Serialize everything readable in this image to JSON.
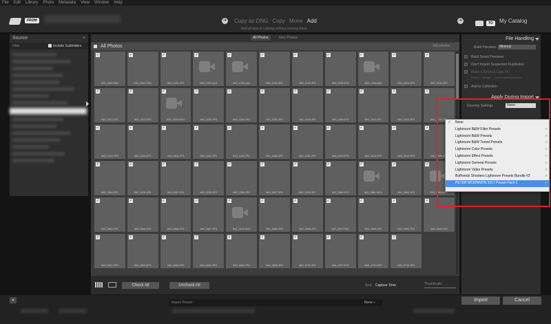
{
  "menubar": [
    "File",
    "Edit",
    "Library",
    "Photo",
    "Metadata",
    "View",
    "Window",
    "Help"
  ],
  "header": {
    "from_badge": "FROM",
    "modes": [
      "Copy as DNG",
      "Copy",
      "Move",
      "Add"
    ],
    "active_mode": "Add",
    "mode_subtitle": "Add photos to catalog without moving them",
    "to_badge": "TO",
    "destination": "My Catalog"
  },
  "source": {
    "title": "Source",
    "add": "+",
    "path_label": "Files",
    "include_subfolders": "Include Subfolders"
  },
  "center": {
    "tabs": [
      "All Photos",
      "New Photos"
    ],
    "section_title": "All Photos",
    "photo_count": "349 photos",
    "photos": [
      {
        "name": "IMG_0150.PNG",
        "video": false
      },
      {
        "name": "IMG_0151.PNG",
        "video": false
      },
      {
        "name": "IMG_0190.JPG",
        "video": false
      },
      {
        "name": "IMG_0191.mp4",
        "video": true
      },
      {
        "name": "IMG_0192.mp4",
        "video": true
      },
      {
        "name": "IMG_0193.JPG",
        "video": false
      },
      {
        "name": "IMG_0194.JPG",
        "video": false
      },
      {
        "name": "IMG_0195.JPG",
        "video": false
      },
      {
        "name": "IMG_0196.mp4",
        "video": true
      },
      {
        "name": "IMG_0201.JPG",
        "video": false
      },
      {
        "name": "IMG_0211.JPG",
        "video": false
      },
      {
        "name": "IMG_0212.JPG",
        "video": false
      },
      {
        "name": "IMG_0215.JPG",
        "video": false
      },
      {
        "name": "IMG_0220.MOV",
        "video": true
      },
      {
        "name": "IMG_0228.JPG",
        "video": false
      },
      {
        "name": "IMG_0244.JPG",
        "video": false
      },
      {
        "name": "IMG_0293.JPG",
        "video": false
      },
      {
        "name": "IMG_0294.JPG",
        "video": false
      },
      {
        "name": "IMG_0399.JPG",
        "video": false
      },
      {
        "name": "IMG_0412.JPG",
        "video": false
      },
      {
        "name": "IMG_0413.JPG",
        "video": false
      },
      {
        "name": "IMG_0414.JPG",
        "video": false
      },
      {
        "name": "IMG_0415.JPG",
        "video": false
      },
      {
        "name": "IMG_0418.JPG",
        "video": false
      },
      {
        "name": "IMG_0468.JPG",
        "video": false
      },
      {
        "name": "IMG_0481.JPG",
        "video": false
      },
      {
        "name": "IMG_0482.JPG",
        "video": false
      },
      {
        "name": "IMG_0488.JPG",
        "video": false
      },
      {
        "name": "IMG_0491.JPG",
        "video": false
      },
      {
        "name": "IMG_0493.JPG",
        "video": false
      },
      {
        "name": "IMG_0516.JPG",
        "video": false
      },
      {
        "name": "IMG_0519.JPG",
        "video": false
      },
      {
        "name": "IMG_0520.JPG",
        "video": false
      },
      {
        "name": "IMG_0544.JPG",
        "video": false
      },
      {
        "name": "IMG_0530.JPG",
        "video": false
      },
      {
        "name": "IMG_0537.JPG",
        "video": false
      },
      {
        "name": "IMG_0535.JPG",
        "video": false
      },
      {
        "name": "IMG_0536.JPG",
        "video": false
      },
      {
        "name": "IMG_0537.JPG",
        "video": false
      },
      {
        "name": "IMG_0539.JPG",
        "video": false
      },
      {
        "name": "IMG_0560.JPG",
        "video": false
      },
      {
        "name": "IMG_0561.MOV",
        "video": true
      },
      {
        "name": "IMG_0562.JPG",
        "video": false
      },
      {
        "name": "IMG_0563.MOV",
        "video": true
      },
      {
        "name": "IMG_0564.JPG",
        "video": false
      },
      {
        "name": "IMG_0565.JPG",
        "video": false
      },
      {
        "name": "IMG_0566.JPG",
        "video": false
      },
      {
        "name": "IMG_0567.JPG",
        "video": false
      },
      {
        "name": "IMG_0574.MOV",
        "video": true
      },
      {
        "name": "IMG_0586.JPG",
        "video": false
      },
      {
        "name": "IMG_0588.JPG",
        "video": false
      },
      {
        "name": "IMG_0597.PNG",
        "video": false
      },
      {
        "name": "IMG_0598.JPG",
        "video": false
      },
      {
        "name": "IMG_0599.JPG",
        "video": false
      },
      {
        "name": "IMG_0600.JPG",
        "video": false
      },
      {
        "name": "IMG_0627.JPG",
        "video": false
      },
      {
        "name": "IMG_0649.JPG",
        "video": false
      },
      {
        "name": "IMG_0650.JPG",
        "video": false
      },
      {
        "name": "IMG_0652.JPG",
        "video": false
      },
      {
        "name": "IMG_0654.JPG",
        "video": false
      },
      {
        "name": "IMG_0696.JPG",
        "video": false
      },
      {
        "name": "IMG_0702.JPG",
        "video": false
      },
      {
        "name": "IMG_0707.JPG",
        "video": false
      },
      {
        "name": "IMG_0710.JPG",
        "video": false
      },
      {
        "name": "IMG_0713.JPG",
        "video": false
      }
    ],
    "check_all": "Check All",
    "uncheck_all": "Uncheck All",
    "sort_label": "Sort:",
    "sort_value": "Capture Time",
    "thumbnails_label": "Thumbnails"
  },
  "file_handling": {
    "title": "File Handling",
    "build_previews_label": "Build Previews",
    "build_previews_value": "Minimal",
    "build_smart_previews": "Build Smart Previews",
    "dont_import_duplicates": "Don't Import Suspected Duplicates",
    "make_second_copy": "Make a Second Copy To:",
    "second_copy_path": "/Users/.../Image ... Downloaded Backups",
    "add_to_collection": "Add to Collection"
  },
  "apply_during_import": {
    "title": "Apply During Import",
    "develop_settings_label": "Develop Settings",
    "develop_settings_value": "None",
    "options": [
      {
        "label": "None",
        "checked": true,
        "submenu": false
      },
      {
        "label": "Lightroom B&W Filter Presets",
        "checked": false,
        "submenu": true
      },
      {
        "label": "Lightroom B&W Presets",
        "checked": false,
        "submenu": true
      },
      {
        "label": "Lightroom B&W Toned Presets",
        "checked": false,
        "submenu": true
      },
      {
        "label": "Lightroom Color Presets",
        "checked": false,
        "submenu": true
      },
      {
        "label": "Lightroom Effect Presets",
        "checked": false,
        "submenu": true
      },
      {
        "label": "Lightroom General Presets",
        "checked": false,
        "submenu": true
      },
      {
        "label": "Lightroom Video Presets",
        "checked": false,
        "submenu": true
      },
      {
        "label": "Buffnerds Shooters Lightroom Presets Bundle #3",
        "checked": false,
        "submenu": true
      },
      {
        "label": "PETER MCKINNON 2017 Preset Pack 2",
        "checked": false,
        "submenu": true
      }
    ],
    "selected_index": 9
  },
  "footer": {
    "collapse": "▲",
    "import_preset_label": "Import Preset :",
    "import_preset_value": "None ÷",
    "import": "Import",
    "cancel": "Cancel"
  },
  "colors": {
    "highlight": "#e0202a",
    "menu_selection": "#4a8fe2"
  }
}
